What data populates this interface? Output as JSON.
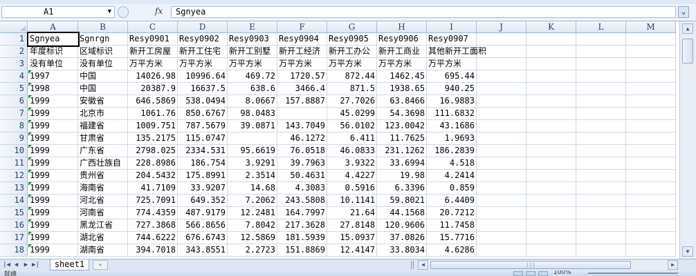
{
  "formula_bar": {
    "name_box": "A1",
    "fx_label": "fx",
    "content": "Sgnyea"
  },
  "columns": [
    "A",
    "B",
    "C",
    "D",
    "E",
    "F",
    "G",
    "H",
    "I",
    "J",
    "K",
    "L",
    "M"
  ],
  "rows": [
    {
      "n": "1",
      "cells": [
        "Sgnyea",
        "Sgnrgn",
        "Resy0901",
        "Resy0902",
        "Resy0903",
        "Resy0904",
        "Resy0905",
        "Resy0906",
        "Resy0907"
      ]
    },
    {
      "n": "2",
      "cells": [
        "年度标识",
        "区域标识",
        "新开工房屋",
        "新开工住宅",
        "新开工别墅",
        "新开工经济",
        "新开工办公",
        "新开工商业",
        "其他新开工面积"
      ]
    },
    {
      "n": "3",
      "cells": [
        "没有单位",
        "没有单位",
        "万平方米",
        "万平方米",
        "万平方米",
        "万平方米",
        "万平方米",
        "万平方米",
        "万平方米"
      ]
    },
    {
      "n": "4",
      "cells": [
        "1997",
        "中国",
        "14026.98",
        "10996.64",
        "469.72",
        "1720.57",
        "872.44",
        "1462.45",
        "695.44"
      ]
    },
    {
      "n": "5",
      "cells": [
        "1998",
        "中国",
        "20387.9",
        "16637.5",
        "638.6",
        "3466.4",
        "871.5",
        "1938.65",
        "940.25"
      ]
    },
    {
      "n": "6",
      "cells": [
        "1999",
        "安徽省",
        "646.5869",
        "538.0494",
        "8.0667",
        "157.8887",
        "27.7026",
        "63.8466",
        "16.9883"
      ]
    },
    {
      "n": "7",
      "cells": [
        "1999",
        "北京市",
        "1061.76",
        "850.6767",
        "98.0483",
        "",
        "45.0299",
        "54.3698",
        "111.6832"
      ]
    },
    {
      "n": "8",
      "cells": [
        "1999",
        "福建省",
        "1009.751",
        "787.5679",
        "39.0871",
        "143.7049",
        "56.0102",
        "123.0042",
        "43.1686"
      ]
    },
    {
      "n": "9",
      "cells": [
        "1999",
        "甘肃省",
        "135.2175",
        "115.0747",
        "",
        "46.1272",
        "6.411",
        "11.7625",
        "1.9693"
      ]
    },
    {
      "n": "10",
      "cells": [
        "1999",
        "广东省",
        "2798.025",
        "2334.531",
        "95.6619",
        "76.0518",
        "46.0833",
        "231.1262",
        "186.2839"
      ]
    },
    {
      "n": "11",
      "cells": [
        "1999",
        "广西壮族自",
        "228.8986",
        "186.754",
        "3.9291",
        "39.7963",
        "3.9322",
        "33.6994",
        "4.518"
      ]
    },
    {
      "n": "12",
      "cells": [
        "1999",
        "贵州省",
        "204.5432",
        "175.8991",
        "2.3514",
        "50.4631",
        "4.4227",
        "19.98",
        "4.2414"
      ]
    },
    {
      "n": "13",
      "cells": [
        "1999",
        "海南省",
        "41.7109",
        "33.9207",
        "14.68",
        "4.3083",
        "0.5916",
        "6.3396",
        "0.859"
      ]
    },
    {
      "n": "14",
      "cells": [
        "1999",
        "河北省",
        "725.7091",
        "649.352",
        "7.2062",
        "243.5808",
        "10.1141",
        "59.8021",
        "6.4409"
      ]
    },
    {
      "n": "15",
      "cells": [
        "1999",
        "河南省",
        "774.4359",
        "487.9179",
        "12.2481",
        "164.7997",
        "21.64",
        "44.1568",
        "20.7212"
      ]
    },
    {
      "n": "16",
      "cells": [
        "1999",
        "黑龙江省",
        "727.3868",
        "566.8656",
        "7.8042",
        "217.3628",
        "27.8148",
        "120.9606",
        "11.7458"
      ]
    },
    {
      "n": "17",
      "cells": [
        "1999",
        "湖北省",
        "744.6222",
        "676.6743",
        "12.5869",
        "181.5939",
        "15.0937",
        "37.0826",
        "15.7716"
      ]
    },
    {
      "n": "18",
      "cells": [
        "1999",
        "湖南省",
        "394.7018",
        "343.8551",
        "2.2723",
        "151.8869",
        "12.4147",
        "33.8034",
        "4.6286"
      ]
    }
  ],
  "sheet_tabs": [
    "sheet1"
  ],
  "status": {
    "ready": "就绪",
    "zoom": "100%"
  },
  "colors": {
    "selection": "#000000",
    "error_triangle": "#1e8a3a",
    "header_bg": "#dde6f2"
  }
}
